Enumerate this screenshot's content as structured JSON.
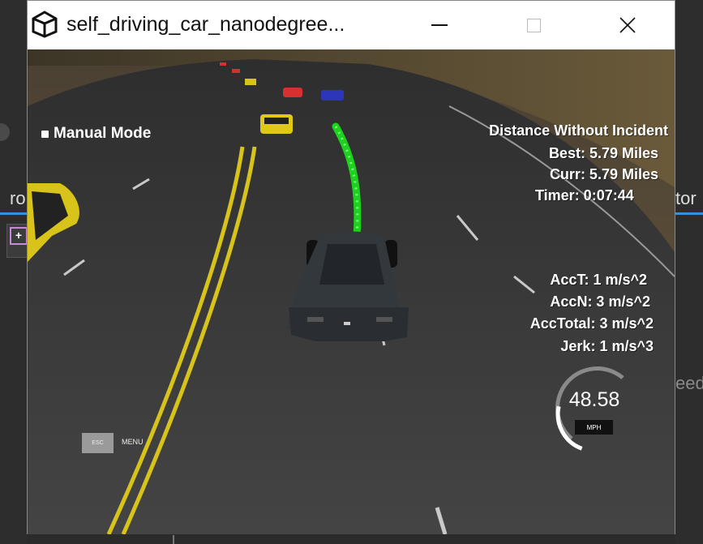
{
  "background": {
    "left_fragment": "ro",
    "right_fragment_top": "tor",
    "right_fragment_mid": "eed"
  },
  "window": {
    "title": "self_driving_car_nanodegree...",
    "buttons": {
      "minimize": "minimize",
      "maximize": "maximize",
      "close": "close"
    }
  },
  "hud": {
    "manual_mode_label": "Manual Mode",
    "distance_heading": "Distance Without Incident",
    "best": "Best: 5.79 Miles",
    "curr": "Curr: 5.79 Miles",
    "timer": "Timer: 0:07:44",
    "acc_t": "AccT: 1 m/s^2",
    "acc_n": "AccN: 3 m/s^2",
    "acc_total": "AccTotal: 3 m/s^2",
    "jerk": "Jerk: 1 m/s^3",
    "esc_label": "ESC",
    "menu_label": "MENU",
    "speed": "48.58",
    "speed_unit": "MPH",
    "speed_fraction": 0.55
  },
  "colors": {
    "path": "#22dd22",
    "road": "#3d3d3d",
    "lane_yellow": "#d8c31a",
    "accent": "#3a8fd6"
  }
}
